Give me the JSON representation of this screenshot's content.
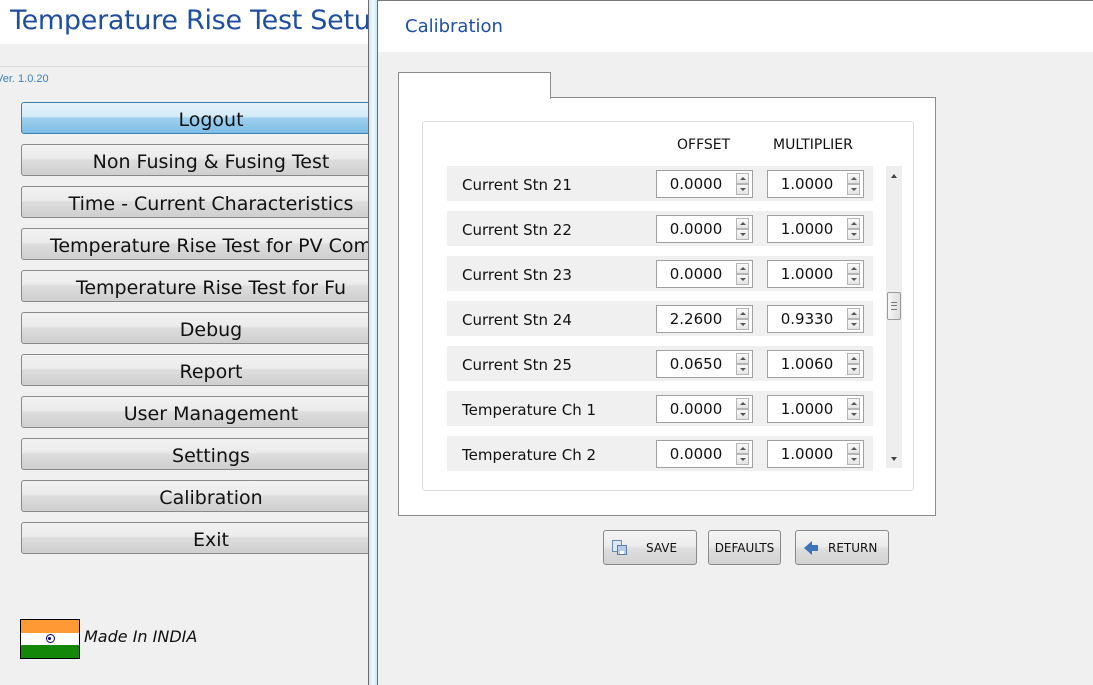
{
  "main": {
    "title": "Temperature Rise Test Setup",
    "version": "Ver. 1.0.20",
    "menu": [
      {
        "label": "Logout",
        "active": true
      },
      {
        "label": "Non Fusing & Fusing Test"
      },
      {
        "label": "Time - Current Characteristics"
      },
      {
        "label": "Temperature Rise Test for PV Com"
      },
      {
        "label": "Temperature Rise Test for Fu"
      },
      {
        "label": "Debug"
      },
      {
        "label": "Report"
      },
      {
        "label": "User Management"
      },
      {
        "label": "Settings"
      },
      {
        "label": "Calibration"
      },
      {
        "label": "Exit"
      }
    ],
    "made_in": "Made In INDIA",
    "flag_icon": "india-flag-icon"
  },
  "calibration": {
    "title": "Calibration",
    "tab_label": "",
    "columns": {
      "offset": "OFFSET",
      "multiplier": "MULTIPLIER"
    },
    "rows": [
      {
        "label": "Current Stn 21",
        "offset": "0.0000",
        "multiplier": "1.0000"
      },
      {
        "label": "Current Stn 22",
        "offset": "0.0000",
        "multiplier": "1.0000"
      },
      {
        "label": "Current Stn 23",
        "offset": "0.0000",
        "multiplier": "1.0000"
      },
      {
        "label": "Current Stn 24",
        "offset": "2.2600",
        "multiplier": "0.9330"
      },
      {
        "label": "Current Stn 25",
        "offset": "0.0650",
        "multiplier": "1.0060"
      },
      {
        "label": "Temperature Ch 1",
        "offset": "0.0000",
        "multiplier": "1.0000"
      },
      {
        "label": "Temperature Ch 2",
        "offset": "0.0000",
        "multiplier": "1.0000"
      }
    ],
    "buttons": {
      "save": "SAVE",
      "defaults": "DEFAULTS",
      "return": "RETURN"
    },
    "icons": {
      "save": "save-icon",
      "return": "back-arrow-icon"
    },
    "colors": {
      "title_blue": "#1f4fa3",
      "active_button": "#7dbde6"
    }
  }
}
